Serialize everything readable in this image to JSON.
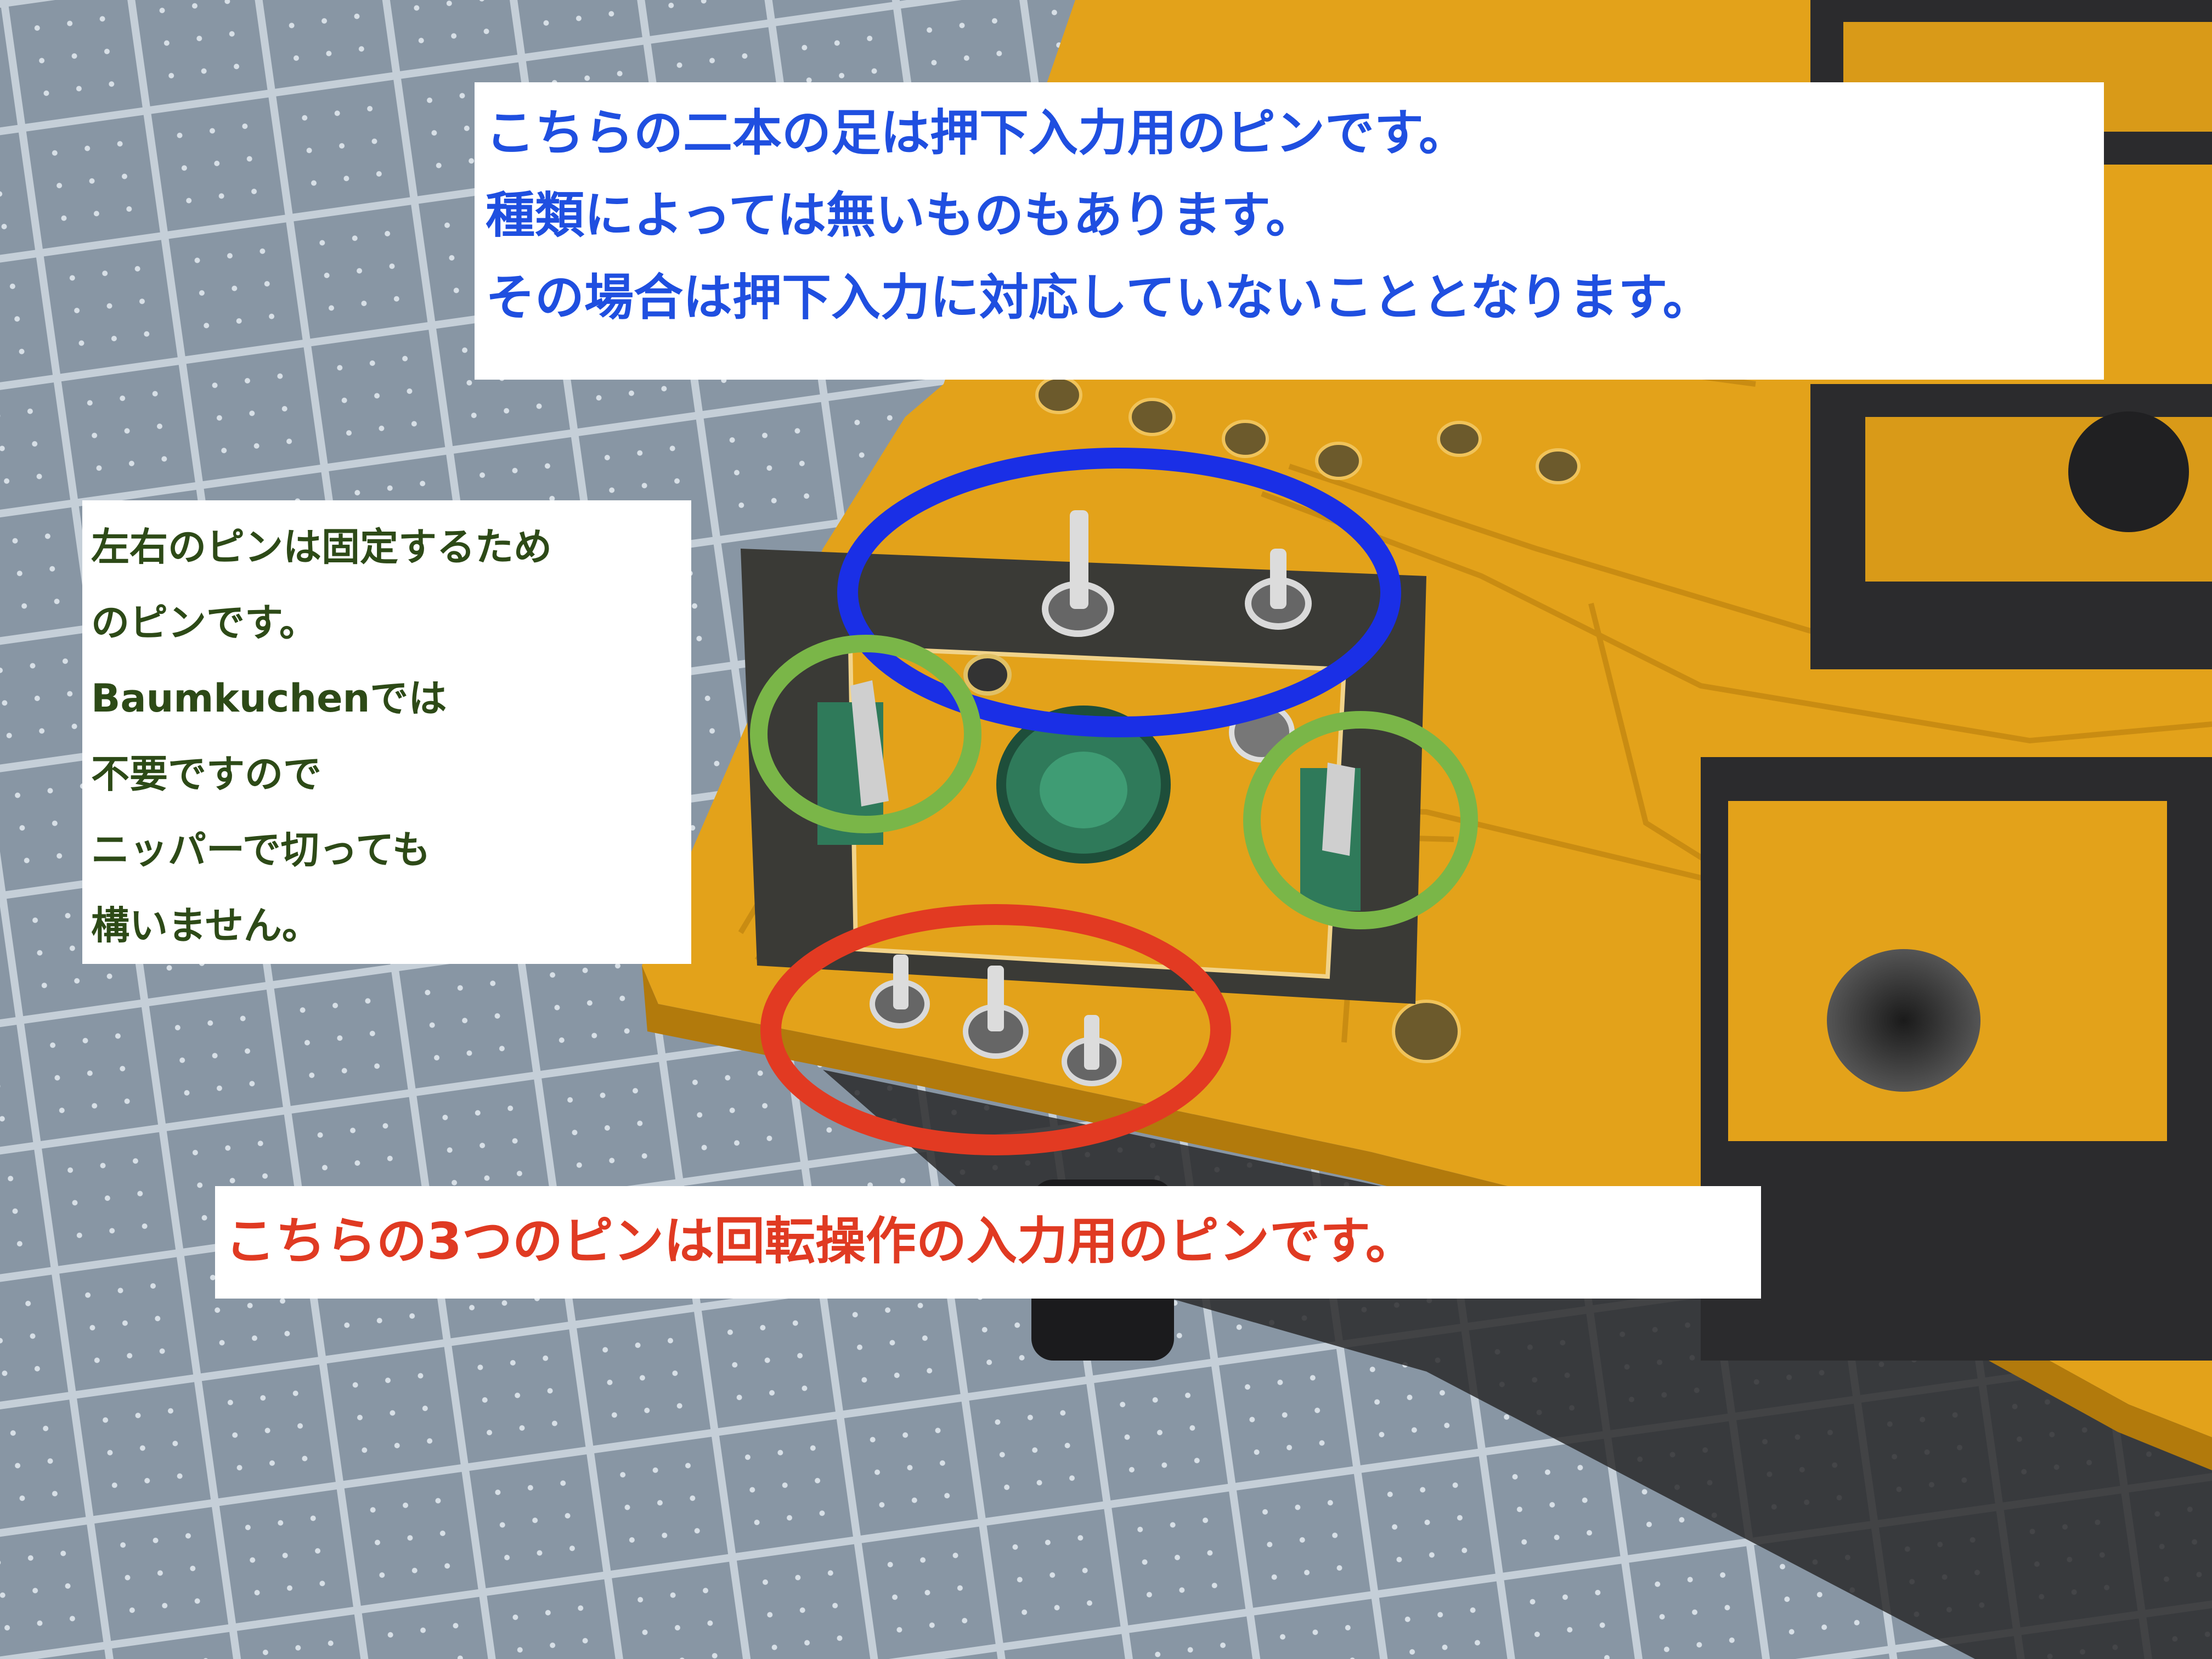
{
  "annotations": {
    "push_pins": {
      "lines": [
        "こちらの二本の足は押下入力用のピンです。",
        "種類によっては無いものもあります。",
        "その場合は押下入力に対応していないこととなります。"
      ],
      "color": "#1f4fe0",
      "circle_color": "#1a2fe6"
    },
    "fixing_pins": {
      "lines": [
        "左右のピンは固定するため",
        "のピンです。",
        "Baumkuchenでは",
        "不要ですので",
        "ニッパーで切っても",
        "構いません。"
      ],
      "color": "#2d4a17",
      "circle_color": "#7ab648"
    },
    "rotation_pins": {
      "lines": [
        "こちらの3つのピンは回転操作の入力用のピンです。"
      ],
      "color": "#e03a22",
      "circle_color": "#e23a22"
    }
  },
  "colors": {
    "pcb": "#e3a21a",
    "pcb_dark": "#c98c12",
    "mat": "#8a98a6",
    "grid": "#c9d3dc",
    "encoder_green": "#2f7a5a"
  }
}
